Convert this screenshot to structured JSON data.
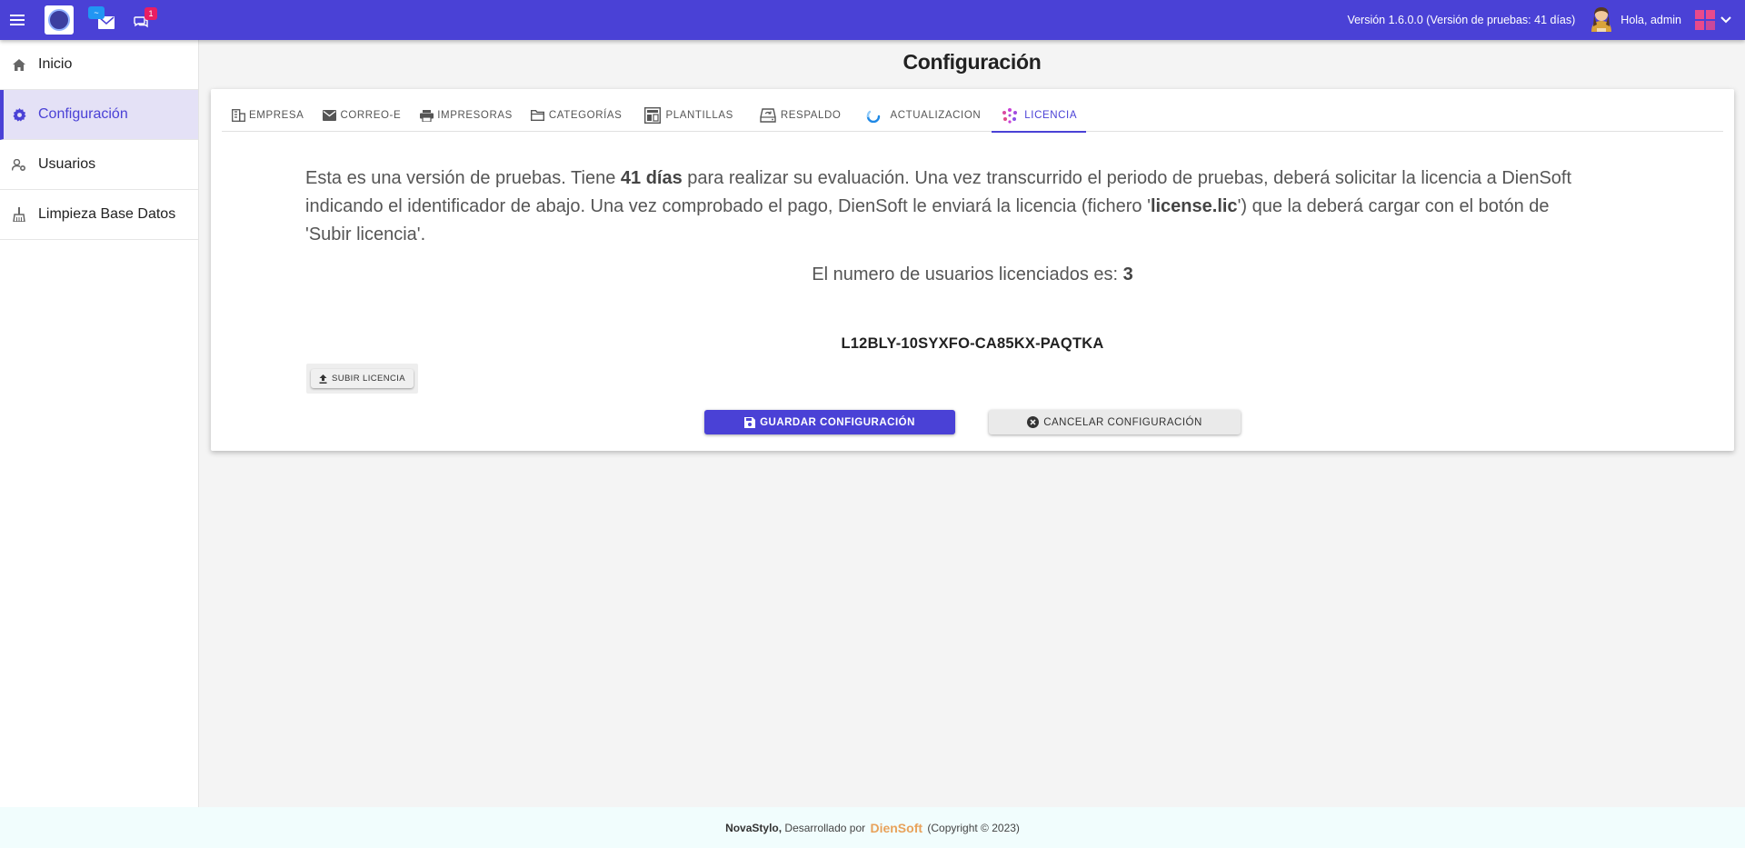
{
  "topbar": {
    "messages_badge": "~",
    "chat_badge": "1",
    "version": "Versión 1.6.0.0 (Versión de pruebas: 41 días)",
    "greeting": "Hola, admin",
    "colors": {
      "bar": "#4a41d6",
      "badge_blue": "#2196f3",
      "badge_red": "#e91e63"
    }
  },
  "sidebar": {
    "items": [
      {
        "label": "Inicio",
        "icon": "home-icon"
      },
      {
        "label": "Configuración",
        "icon": "gear-icon",
        "active": true
      },
      {
        "label": "Usuarios",
        "icon": "users-settings-icon"
      },
      {
        "label": "Limpieza Base Datos",
        "icon": "broom-icon"
      }
    ]
  },
  "page": {
    "title": "Configuración"
  },
  "tabs": [
    {
      "label": "EMPRESA",
      "icon": "building-icon"
    },
    {
      "label": "CORREO-E",
      "icon": "mail-icon"
    },
    {
      "label": "IMPRESORAS",
      "icon": "printer-icon"
    },
    {
      "label": "CATEGORÍAS",
      "icon": "folder-icon"
    },
    {
      "label": "PLANTILLAS",
      "icon": "template-icon"
    },
    {
      "label": "RESPALDO",
      "icon": "backup-icon"
    },
    {
      "label": "ACTUALIZACION",
      "icon": "spinner-icon"
    },
    {
      "label": "LICENCIA",
      "icon": "license-icon",
      "active": true
    }
  ],
  "license": {
    "info_1": "Esta es una versión de pruebas. Tiene ",
    "days": "41 días",
    "info_2": " para realizar su evaluación. Una vez transcurrido el periodo de pruebas, deberá solicitar la licencia a DienSoft indicando el identificador de abajo. Una vez comprobado el pago, DienSoft le enviará la licencia (fichero '",
    "file": "license.lic",
    "info_3": "') que la deberá cargar con el botón de 'Subir licencia'.",
    "users_text": "El numero de usuarios licenciados es: ",
    "users_count": "3",
    "key": "L12BLY-10SYXFO-CA85KX-PAQTKA",
    "upload_label": "SUBIR LICENCIA"
  },
  "actions": {
    "save_label": "GUARDAR CONFIGURACIÓN",
    "cancel_label": "CANCELAR CONFIGURACIÓN"
  },
  "footer": {
    "brand": "NovaStylo,",
    "developed_by": " Desarrollado por ",
    "company": "DienSoft",
    "copyright": " (Copyright © 2023)",
    "company_color": "#e8a25b"
  }
}
